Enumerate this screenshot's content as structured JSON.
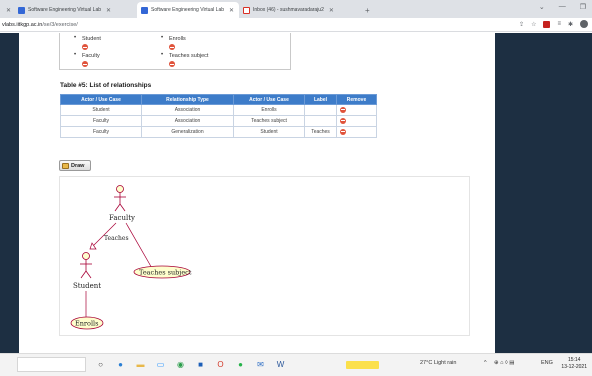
{
  "browser": {
    "tabs": [
      {
        "label": "Software Engineering Virtual Lab",
        "active": false
      },
      {
        "label": "Software Engineering Virtual Lab",
        "active": true
      },
      {
        "label": "Inbox (46) - sushmavaradaraju2",
        "active": false
      }
    ],
    "url_host": "vlabs.iitkgp.ac.in",
    "url_path": "/se/3/exercise/"
  },
  "top_lists": {
    "left": [
      "Student",
      "Faculty"
    ],
    "right": [
      "Enrolls",
      "Teaches subject"
    ]
  },
  "table": {
    "caption": "Table #5: List of relationships",
    "headers": [
      "Actor / Use Case",
      "Relationship Type",
      "Actor / Use Case",
      "Label",
      "Remove"
    ],
    "rows": [
      [
        "Student",
        "Association",
        "Enrolls",
        ""
      ],
      [
        "Faculty",
        "Association",
        "Teaches subject",
        ""
      ],
      [
        "Faculty",
        "Generalization",
        "Student",
        "Teaches"
      ]
    ]
  },
  "draw_button": {
    "label": "Draw"
  },
  "diagram": {
    "actors": [
      "Faculty",
      "Student"
    ],
    "use_cases": [
      "Teaches subject",
      "Enrolls"
    ],
    "edge_label": "Teaches"
  },
  "taskbar": {
    "weather": "27°C  Light rain",
    "language": "ENG",
    "time": "15:14",
    "date": "13-12-2021"
  },
  "colors": {
    "page_side": "#1d2f42",
    "table_header": "#3d7cc9",
    "use_case_fill": "#fefecd",
    "use_case_stroke": "#a80036",
    "remove_icon": "#e0533b"
  }
}
